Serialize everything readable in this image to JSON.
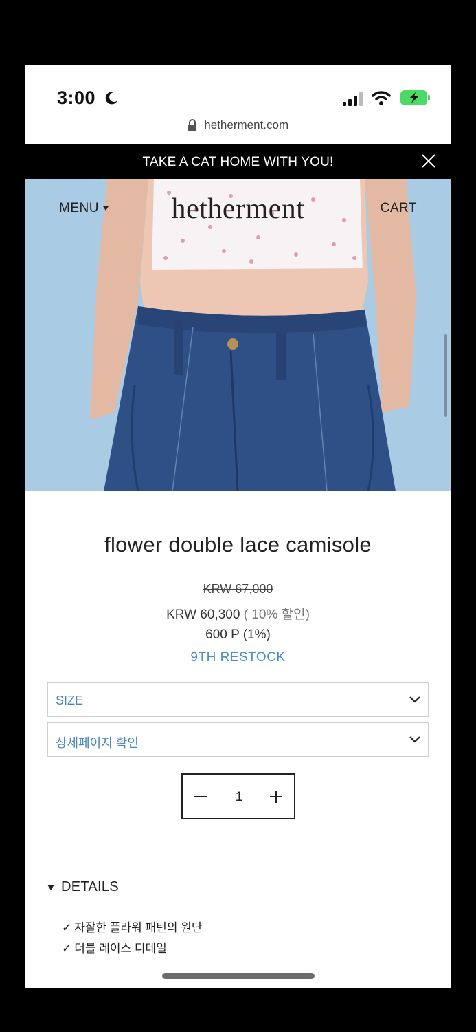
{
  "status_bar": {
    "time": "3:00",
    "icons": [
      "moon-icon",
      "signal-icon",
      "wifi-icon",
      "battery-charging-icon"
    ]
  },
  "browser": {
    "url": "hetherment.com",
    "lock_icon": "lock-icon"
  },
  "announcement": {
    "text": "TAKE A CAT HOME WITH YOU!",
    "close_icon": "close-icon"
  },
  "header": {
    "menu_label": "MENU",
    "logo_text": "hetherment",
    "cart_label": "CART"
  },
  "product": {
    "title": "flower double lace camisole",
    "original_price": "KRW 67,000",
    "sale_price": "KRW 60,300",
    "discount": "( 10% 할인)",
    "points": "600 P (1%)",
    "restock_label": "9TH RESTOCK"
  },
  "options": {
    "size_label": "SIZE",
    "detail_label": "상세페이지 확인"
  },
  "quantity": {
    "value": "1"
  },
  "details": {
    "label": "DETAILS",
    "items": [
      "자잘한 플라워 패턴의 원단",
      "더블 레이스 디테일"
    ],
    "check_glyph": "✓"
  },
  "colors": {
    "accent_blue": "#4a90c0",
    "announcement_bg": "#000000",
    "hero_bg": "#a9cbe4",
    "battery_green": "#4cd964"
  }
}
